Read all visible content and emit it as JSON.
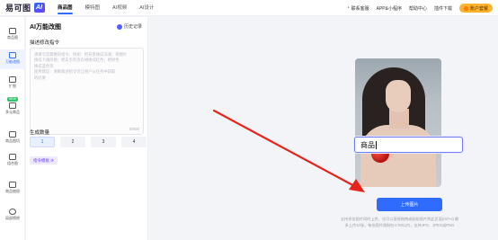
{
  "app": {
    "logo_text": "易可图",
    "logo_mark": "AI"
  },
  "topnav": [
    {
      "label": "商品图",
      "active": true
    },
    {
      "label": "模特图",
      "active": false
    },
    {
      "label": "AI视频",
      "active": false
    },
    {
      "label": "AI设计",
      "active": false
    }
  ],
  "topright": {
    "contact": "联系客服",
    "app": "APP&小程序",
    "help": "帮助中心",
    "download": "插件下载",
    "vip": "账户套餐"
  },
  "rail": [
    {
      "label": "商品图",
      "icon": "image-icon"
    },
    {
      "label": "万能改图",
      "icon": "edit-image-icon",
      "active": true
    },
    {
      "label": "扩图",
      "icon": "expand-icon"
    },
    {
      "label": "多元商品",
      "icon": "multi-product-icon",
      "badge": "NEW"
    },
    {
      "label": "商品图切",
      "icon": "cut-icon"
    },
    {
      "label": "组合图",
      "icon": "combine-icon"
    },
    {
      "label": "商品抽屉",
      "icon": "drawer-icon"
    },
    {
      "label": "局部擦除",
      "icon": "erase-icon"
    }
  ],
  "panel": {
    "title": "AI万能改图",
    "history": "历史记录",
    "desc_label": "描述修改指令",
    "desc_placeholder": [
      "请填写您需要的指令，例如：把背景换成海滩；将图片",
      "换成卡通风格；把白宝的连衣裙换成红色；把绿色",
      "换成蓝色等",
      "使用建议：清晰叙述指令可让用户从任务中获取",
      "的结果"
    ],
    "char_count": "0/500",
    "qty_label": "生成数量",
    "qty_options": [
      "1",
      "2",
      "3",
      "4"
    ],
    "qty_selected": 0,
    "tag_button": "指令模板 ⟳"
  },
  "main": {
    "photo_text": "商品",
    "upload_button": "上传图片",
    "hint_lines": [
      "支持多张图片同时上传，也可以直接拖拽或粘贴图片到此页面(ctrl+v) 最",
      "多上传10张，每张图片限制在4.7M以内，支持JPG、JPEG或PNG"
    ],
    "arrow_color": "#e8231a"
  }
}
